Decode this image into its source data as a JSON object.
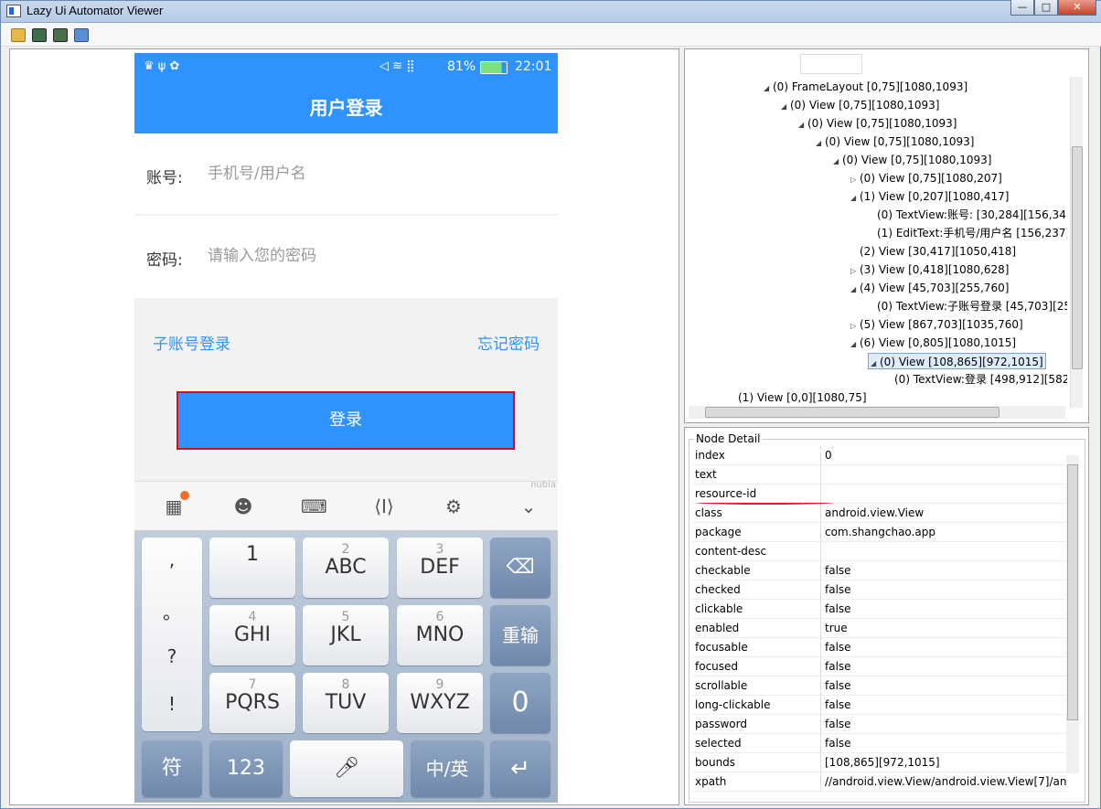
{
  "window": {
    "title": "Lazy Ui Automator Viewer",
    "buttons": [
      "—",
      "□",
      "✕"
    ]
  },
  "toolbar": {
    "icons": [
      "open-folder-icon",
      "screenshot-icon",
      "screenshot-compressed-icon",
      "save-icon"
    ]
  },
  "phone": {
    "status": {
      "left_icons": "♛ ψ ✿",
      "signal": "81%",
      "time": "22:01"
    },
    "title": "用户登录",
    "account": {
      "label": "账号:",
      "placeholder": "手机号/用户名"
    },
    "password": {
      "label": "密码:",
      "placeholder": "请输入您的密码"
    },
    "sub_login": "子账号登录",
    "forgot": "忘记密码",
    "login": "登录",
    "keyboard": {
      "brand": "nubia",
      "punct": [
        ",",
        "。",
        "?",
        "!"
      ],
      "keys": [
        {
          "small": "",
          "big": "1"
        },
        {
          "small": "2",
          "big": "ABC"
        },
        {
          "small": "3",
          "big": "DEF"
        },
        {
          "small": "4",
          "big": "GHI"
        },
        {
          "small": "5",
          "big": "JKL"
        },
        {
          "small": "6",
          "big": "MNO"
        },
        {
          "small": "7",
          "big": "PQRS"
        },
        {
          "small": "8",
          "big": "TUV"
        },
        {
          "small": "9",
          "big": "WXYZ"
        }
      ],
      "retype": "重输",
      "zero": "0",
      "symbols": "符",
      "num": "123",
      "lang": "中/英",
      "enter": "↵"
    }
  },
  "tree": [
    {
      "indent": 4,
      "arrow": "◢",
      "text": "(0) FrameLayout [0,75][1080,1093]"
    },
    {
      "indent": 5,
      "arrow": "◢",
      "text": "(0) View [0,75][1080,1093]"
    },
    {
      "indent": 6,
      "arrow": "◢",
      "text": "(0) View [0,75][1080,1093]"
    },
    {
      "indent": 7,
      "arrow": "◢",
      "text": "(0) View [0,75][1080,1093]"
    },
    {
      "indent": 8,
      "arrow": "◢",
      "text": "(0) View [0,75][1080,1093]"
    },
    {
      "indent": 9,
      "arrow": "▷",
      "text": "(0) View [0,75][1080,207]"
    },
    {
      "indent": 9,
      "arrow": "◢",
      "text": "(1) View [0,207][1080,417]"
    },
    {
      "indent": 10,
      "arrow": "",
      "text": "(0) TextView:账号:  [30,284][156,34"
    },
    {
      "indent": 10,
      "arrow": "",
      "text": "(1) EditText:手机号/用户名 [156,237]"
    },
    {
      "indent": 9,
      "arrow": "",
      "text": "(2) View [30,417][1050,418]"
    },
    {
      "indent": 9,
      "arrow": "▷",
      "text": "(3) View [0,418][1080,628]"
    },
    {
      "indent": 9,
      "arrow": "◢",
      "text": "(4) View [45,703][255,760]"
    },
    {
      "indent": 10,
      "arrow": "",
      "text": "(0) TextView:子账号登录 [45,703][25"
    },
    {
      "indent": 9,
      "arrow": "▷",
      "text": "(5) View [867,703][1035,760]"
    },
    {
      "indent": 9,
      "arrow": "◢",
      "text": "(6) View [0,805][1080,1015]"
    },
    {
      "indent": 10,
      "arrow": "◢",
      "text": "(0) View [108,865][972,1015]",
      "selected": true
    },
    {
      "indent": 11,
      "arrow": "",
      "text": "(0) TextView:登录 [498,912][582"
    },
    {
      "indent": 2,
      "arrow": "",
      "text": "(1) View [0,0][1080,75]"
    }
  ],
  "detail": {
    "title": "Node Detail",
    "rows": [
      {
        "k": "index",
        "v": "0"
      },
      {
        "k": "text",
        "v": ""
      },
      {
        "k": "resource-id",
        "v": ""
      },
      {
        "k": "class",
        "v": "android.view.View"
      },
      {
        "k": "package",
        "v": "com.shangchao.app"
      },
      {
        "k": "content-desc",
        "v": ""
      },
      {
        "k": "checkable",
        "v": "false"
      },
      {
        "k": "checked",
        "v": "false"
      },
      {
        "k": "clickable",
        "v": "false"
      },
      {
        "k": "enabled",
        "v": "true"
      },
      {
        "k": "focusable",
        "v": "false"
      },
      {
        "k": "focused",
        "v": "false"
      },
      {
        "k": "scrollable",
        "v": "false"
      },
      {
        "k": "long-clickable",
        "v": "false"
      },
      {
        "k": "password",
        "v": "false"
      },
      {
        "k": "selected",
        "v": "false"
      },
      {
        "k": "bounds",
        "v": "[108,865][972,1015]"
      },
      {
        "k": "xpath",
        "v": "//android.view.View/android.view.View[7]/an"
      }
    ]
  }
}
